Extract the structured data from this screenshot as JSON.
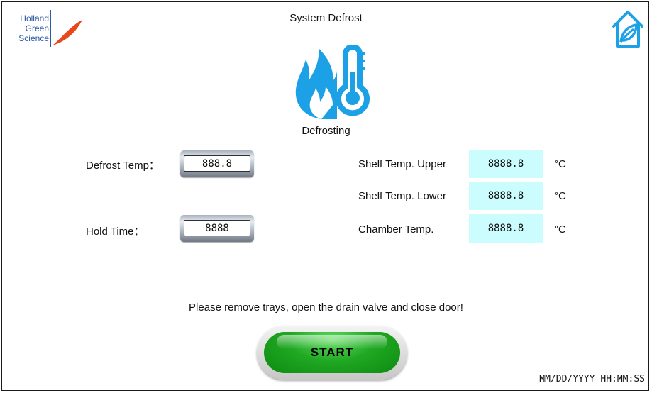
{
  "header": {
    "logo_lines": [
      "Holland",
      "Green",
      "Science"
    ],
    "title": "System Defrost",
    "home_icon": "home-leaf-icon"
  },
  "status": {
    "icon": "flame-thermometer-icon",
    "label": "Defrosting"
  },
  "settings": {
    "defrost_temp_label": "Defrost Temp：",
    "defrost_temp_value": "888.8",
    "hold_time_label": "Hold Time：",
    "hold_time_value": "8888"
  },
  "readings": [
    {
      "label": "Shelf Temp. Upper",
      "value": "8888.8",
      "unit": "°C"
    },
    {
      "label": "Shelf Temp. Lower",
      "value": "8888.8",
      "unit": "°C"
    },
    {
      "label": "Chamber Temp.",
      "value": "8888.8",
      "unit": "°C"
    }
  ],
  "message": "Please remove trays, open the drain valve and close door!",
  "start_label": "START",
  "datetime": "MM/DD/YYYY HH:MM:SS",
  "colors": {
    "accent_blue": "#1da1e6",
    "logo_blue": "#2b5aa7",
    "logo_orange": "#e8471c",
    "readout_bg": "#ccfdfe",
    "start_green": "#20a823"
  }
}
